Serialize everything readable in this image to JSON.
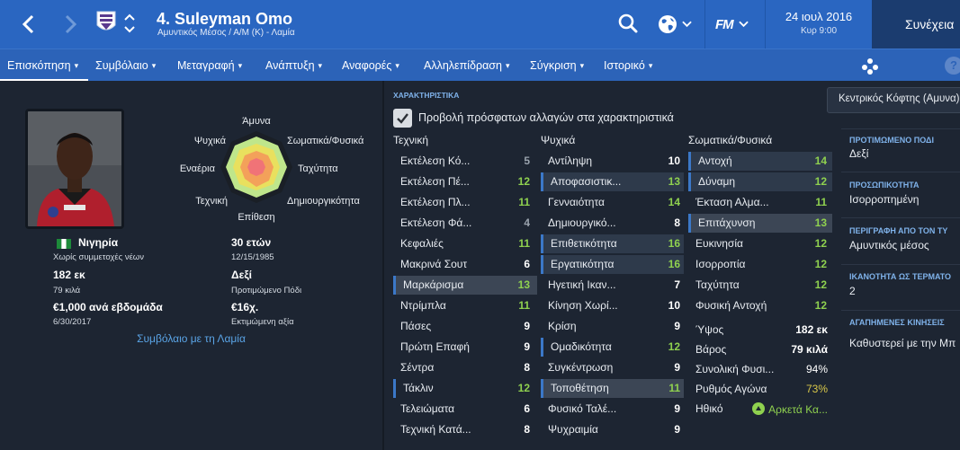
{
  "header": {
    "player_name": "4. Suleyman Omo",
    "subtitle": "Αμυντικός Μέσος / Α/Μ (Κ) - Λαμία",
    "date": "24 ιουλ 2016",
    "time": "Κυρ 9:00",
    "fm_logo": "FM",
    "continue_label": "Συνέχεια"
  },
  "tabs": [
    {
      "label": "Επισκόπηση"
    },
    {
      "label": "Συμβόλαιο"
    },
    {
      "label": "Μεταγραφή"
    },
    {
      "label": "Ανάπτυξη"
    },
    {
      "label": "Αναφορές"
    },
    {
      "label": "Αλληλεπίδραση"
    },
    {
      "label": "Σύγκριση"
    },
    {
      "label": "Ιστορικό"
    }
  ],
  "help_label": "?",
  "radar_labels": {
    "top": "Άμυνα",
    "top_right": "Σωματικά/Φυσικά",
    "right": "Ταχύτητα",
    "bottom_right": "Δημιουργικότητα",
    "bottom": "Επίθεση",
    "bottom_left": "Τεχνική",
    "left": "Εναέρια",
    "top_left": "Ψυχικά"
  },
  "profile": {
    "nationality": "Νιγηρία",
    "youth_caps": "Χωρίς συμμετοχές νέων",
    "height": "182 εκ",
    "weight": "79 κιλά",
    "wage": "€1,000 ανά εβδομάδα",
    "contract_end": "6/30/2017",
    "age": "30 ετών",
    "birth_date": "12/15/1985",
    "preferred_foot": "Δεξί",
    "preferred_foot_label": "Προτιμώμενο Πόδι",
    "value": "€16χ.",
    "value_label": "Εκτιμώμενη αξία",
    "contract_link": "Συμβόλαιο με τη Λαμία"
  },
  "attributes": {
    "section_title": "ΧΑΡΑΚΤΗΡΙΣΤΙΚΑ",
    "recent_changes_label": "Προβολή πρόσφατων αλλαγών στα χαρακτηριστικά",
    "technical": {
      "header": "Τεχνική",
      "rows": [
        {
          "name": "Εκτέλεση Κό...",
          "value": "5"
        },
        {
          "name": "Εκτέλεση Πέ...",
          "value": "12"
        },
        {
          "name": "Εκτέλεση Πλ...",
          "value": "11"
        },
        {
          "name": "Εκτέλεση Φά...",
          "value": "4"
        },
        {
          "name": "Κεφαλιές",
          "value": "11"
        },
        {
          "name": "Μακρινά Σουτ",
          "value": "6"
        },
        {
          "name": "Μαρκάρισμα",
          "value": "13"
        },
        {
          "name": "Ντρίμπλα",
          "value": "11"
        },
        {
          "name": "Πάσες",
          "value": "9"
        },
        {
          "name": "Πρώτη Επαφή",
          "value": "9"
        },
        {
          "name": "Σέντρα",
          "value": "8"
        },
        {
          "name": "Τάκλιν",
          "value": "12"
        },
        {
          "name": "Τελειώματα",
          "value": "6"
        },
        {
          "name": "Τεχνική Κατά...",
          "value": "8"
        }
      ]
    },
    "mental": {
      "header": "Ψυχικά",
      "rows": [
        {
          "name": "Αντίληψη",
          "value": "10"
        },
        {
          "name": "Αποφασιστικ...",
          "value": "13"
        },
        {
          "name": "Γενναιότητα",
          "value": "14"
        },
        {
          "name": "Δημιουργικό...",
          "value": "8"
        },
        {
          "name": "Επιθετικότητα",
          "value": "16"
        },
        {
          "name": "Εργατικότητα",
          "value": "16"
        },
        {
          "name": "Ηγετική Ικαν...",
          "value": "7"
        },
        {
          "name": "Κίνηση Χωρί...",
          "value": "10"
        },
        {
          "name": "Κρίση",
          "value": "9"
        },
        {
          "name": "Ομαδικότητα",
          "value": "12"
        },
        {
          "name": "Συγκέντρωση",
          "value": "9"
        },
        {
          "name": "Τοποθέτηση",
          "value": "11"
        },
        {
          "name": "Φυσικό Ταλέ...",
          "value": "9"
        },
        {
          "name": "Ψυχραιμία",
          "value": "9"
        }
      ]
    },
    "physical": {
      "header": "Σωματικά/Φυσικά",
      "rows": [
        {
          "name": "Αντοχή",
          "value": "14"
        },
        {
          "name": "Δύναμη",
          "value": "12"
        },
        {
          "name": "Έκταση Αλμα...",
          "value": "11"
        },
        {
          "name": "Επιτάχυνση",
          "value": "13"
        },
        {
          "name": "Ευκινησία",
          "value": "12"
        },
        {
          "name": "Ισορροπία",
          "value": "12"
        },
        {
          "name": "Ταχύτητα",
          "value": "12"
        },
        {
          "name": "Φυσική Αντοχή",
          "value": "12"
        }
      ]
    },
    "stats": [
      {
        "name": "Ύψος",
        "value": "182 εκ"
      },
      {
        "name": "Βάρος",
        "value": "79 κιλά"
      },
      {
        "name": "Συνολική Φυσι...",
        "value": "94%"
      },
      {
        "name": "Ρυθμός Αγώνα",
        "value": "73%"
      },
      {
        "name": "Ηθικό",
        "value": "Αρκετά Κα..."
      }
    ]
  },
  "right_panel": {
    "role_dropdown": "Κεντρικός Κόφτης (Αμυνα)",
    "sections": [
      {
        "label": "ΠΡΟΤΙΜΩΜΕΝΟ ΠΟΔΙ",
        "value": "Δεξί"
      },
      {
        "label": "ΠΡΟΣΩΠΙΚΟΤΗΤΑ",
        "value": "Ισορροπημένη"
      },
      {
        "label": "ΠΕΡΙΓΡΑΦΗ ΑΠΟ ΤΟΝ ΤΥ",
        "value": "Αμυντικός μέσος"
      },
      {
        "label": "ΙΚΑΝΟΤΗΤΑ ΩΣ ΤΕΡΜΑΤΟ",
        "value": "2"
      },
      {
        "label": "ΑΓΑΠΗΜΕΝΕΣ ΚΙΝΗΣΕΙΣ",
        "value": "Καθυστερεί με την Μπ"
      }
    ]
  },
  "colors": {
    "header_blue": "#2a66c1",
    "tab_blue": "#2c63b8",
    "value_green": "#8fd14f",
    "value_grey": "#9aa3ad",
    "value_white": "#ffffff",
    "value_yellow": "#d9c84a",
    "link_blue": "#5aa4e6"
  }
}
